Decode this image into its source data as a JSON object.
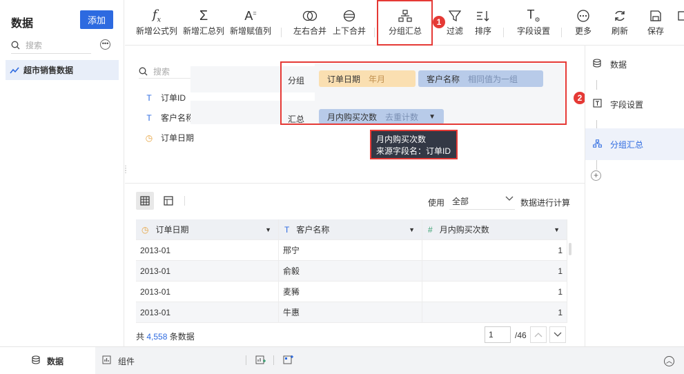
{
  "left_panel": {
    "title": "数据",
    "add_button": "添加",
    "search_placeholder": "搜索",
    "dataset": "超市销售数据"
  },
  "toolbar": {
    "buttons": [
      {
        "label": "新增公式列",
        "icon": "formula-icon"
      },
      {
        "label": "新增汇总列",
        "icon": "sigma-icon"
      },
      {
        "label": "新增赋值列",
        "icon": "assign-icon"
      },
      {
        "label": "左右合并",
        "icon": "merge-horizontal-icon"
      },
      {
        "label": "上下合并",
        "icon": "merge-vertical-icon"
      },
      {
        "label": "分组汇总",
        "icon": "group-icon"
      },
      {
        "label": "过滤",
        "icon": "filter-icon"
      },
      {
        "label": "排序",
        "icon": "sort-icon"
      },
      {
        "label": "字段设置",
        "icon": "field-settings-icon"
      },
      {
        "label": "更多",
        "icon": "more-icon"
      },
      {
        "label": "刷新",
        "icon": "refresh-icon"
      },
      {
        "label": "保存",
        "icon": "save-icon"
      }
    ],
    "badge_1": "1",
    "badge_2": "2"
  },
  "fields": {
    "search_placeholder": "搜索",
    "items": [
      {
        "name": "订单ID",
        "type": "text"
      },
      {
        "name": "客户名称",
        "type": "text"
      },
      {
        "name": "订单日期",
        "type": "date"
      }
    ]
  },
  "group_config": {
    "group_label": "分组",
    "summary_label": "汇总",
    "group_chips": [
      {
        "field": "订单日期",
        "mode": "年月"
      },
      {
        "field": "客户名称",
        "mode": "相同值为一组"
      }
    ],
    "summary_chips": [
      {
        "field": "月内购买次数",
        "mode": "去重计数"
      }
    ],
    "tooltip": {
      "line1": "月内购买次数",
      "line2": "来源字段名：订单ID"
    }
  },
  "preview": {
    "use_label": "使用",
    "use_value": "全部",
    "use_suffix": "数据进行计算",
    "columns": [
      "订单日期",
      "客户名称",
      "月内购买次数"
    ],
    "rows": [
      [
        "2013-01",
        "邢宁",
        "1"
      ],
      [
        "2013-01",
        "俞毅",
        "1"
      ],
      [
        "2013-01",
        "麦豨",
        "1"
      ],
      [
        "2013-01",
        "牛惠",
        "1"
      ]
    ],
    "total_prefix": "共",
    "total_count": "4,558",
    "total_suffix": "条数据",
    "page_current": "1",
    "page_total": "/46"
  },
  "right_panel": {
    "items": [
      "数据",
      "字段设置",
      "分组汇总"
    ]
  },
  "bottom": {
    "tab_data": "数据",
    "tab_component": "组件"
  },
  "colors": {
    "accent": "#2d6ae0",
    "highlight": "#e53935",
    "chip_orange": "#fadfb1",
    "chip_blue": "#b8cbe9"
  }
}
